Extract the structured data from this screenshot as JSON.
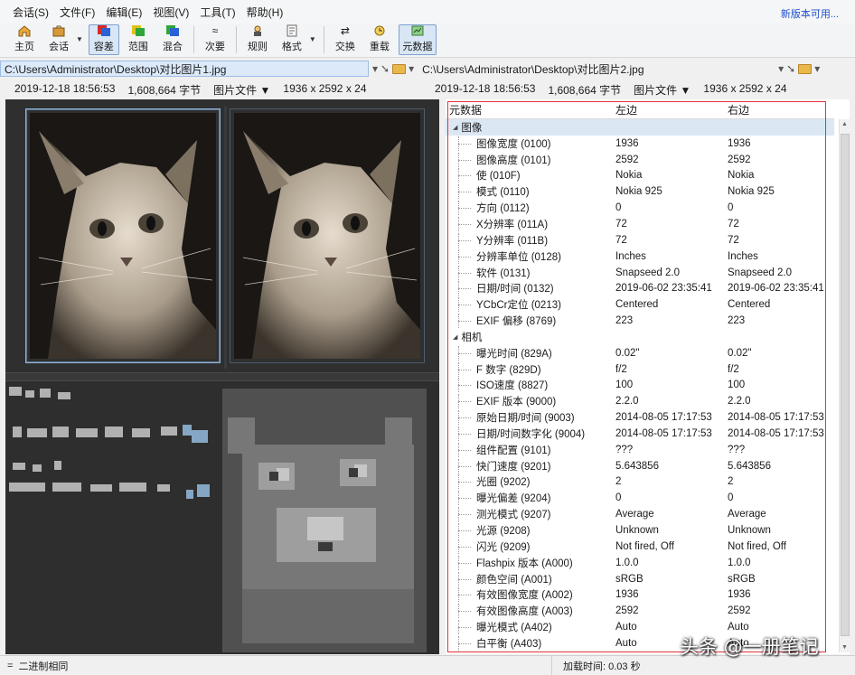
{
  "menu": {
    "items": [
      "会话(S)",
      "文件(F)",
      "编辑(E)",
      "视图(V)",
      "工具(T)",
      "帮助(H)"
    ],
    "update_link": "新版本可用..."
  },
  "toolbar": {
    "home": "主页",
    "session": "会话",
    "diff": "容差",
    "range": "范围",
    "mix": "混合",
    "minor": "次要",
    "rules": "规则",
    "format": "格式",
    "swap": "交换",
    "reload": "重载",
    "metadata": "元数据"
  },
  "paths": {
    "left": "C:\\Users\\Administrator\\Desktop\\对比图片1.jpg",
    "right": "C:\\Users\\Administrator\\Desktop\\对比图片2.jpg"
  },
  "file_info": {
    "left": {
      "date": "2019-12-18 18:56:53",
      "size": "1,608,664 字节",
      "type": "图片文件",
      "dims": "1936 x 2592 x 24"
    },
    "right": {
      "date": "2019-12-18 18:56:53",
      "size": "1,608,664 字节",
      "type": "图片文件",
      "dims": "1936 x 2592 x 24"
    }
  },
  "meta_table": {
    "headers": [
      "元数据",
      "左边",
      "右边"
    ],
    "groups": [
      {
        "name": "图像",
        "rows": [
          [
            "图像宽度 (0100)",
            "1936",
            "1936"
          ],
          [
            "图像高度 (0101)",
            "2592",
            "2592"
          ],
          [
            "使 (010F)",
            "Nokia",
            "Nokia"
          ],
          [
            "模式 (0110)",
            "Nokia 925",
            "Nokia 925"
          ],
          [
            "方向 (0112)",
            "0",
            "0"
          ],
          [
            "X分辨率 (011A)",
            "72",
            "72"
          ],
          [
            "Y分辨率 (011B)",
            "72",
            "72"
          ],
          [
            "分辨率单位 (0128)",
            "Inches",
            "Inches"
          ],
          [
            "软件 (0131)",
            "Snapseed 2.0",
            "Snapseed 2.0"
          ],
          [
            "日期/时间 (0132)",
            "2019-06-02 23:35:41",
            "2019-06-02 23:35:41"
          ],
          [
            "YCbCr定位 (0213)",
            "Centered",
            "Centered"
          ],
          [
            "EXIF 偏移 (8769)",
            "223",
            "223"
          ]
        ]
      },
      {
        "name": "相机",
        "rows": [
          [
            "曝光时间 (829A)",
            "0.02\"",
            "0.02\""
          ],
          [
            "F 数字 (829D)",
            "f/2",
            "f/2"
          ],
          [
            "ISO速度 (8827)",
            "100",
            "100"
          ],
          [
            "EXIF 版本 (9000)",
            "2.2.0",
            "2.2.0"
          ],
          [
            "原始日期/时间 (9003)",
            "2014-08-05 17:17:53",
            "2014-08-05 17:17:53"
          ],
          [
            "日期/时间数字化 (9004)",
            "2014-08-05 17:17:53",
            "2014-08-05 17:17:53"
          ],
          [
            "组件配置 (9101)",
            "???",
            "???"
          ],
          [
            "快门速度 (9201)",
            "5.643856",
            "5.643856"
          ],
          [
            "光圈 (9202)",
            "2",
            "2"
          ],
          [
            "曝光偏差 (9204)",
            "0",
            "0"
          ],
          [
            "测光模式 (9207)",
            "Average",
            "Average"
          ],
          [
            "光源 (9208)",
            "Unknown",
            "Unknown"
          ],
          [
            "闪光 (9209)",
            "Not fired, Off",
            "Not fired, Off"
          ],
          [
            "Flashpix 版本 (A000)",
            "1.0.0",
            "1.0.0"
          ],
          [
            "颜色空间 (A001)",
            "sRGB",
            "sRGB"
          ],
          [
            "有效图像宽度 (A002)",
            "1936",
            "1936"
          ],
          [
            "有效图像高度 (A003)",
            "2592",
            "2592"
          ],
          [
            "曝光模式 (A402)",
            "Auto",
            "Auto"
          ],
          [
            "白平衡 (A403)",
            "Auto",
            "Auto"
          ]
        ]
      }
    ]
  },
  "status": {
    "left": "二进制相同",
    "right": "加载时间: 0.03 秒"
  },
  "watermark": "头条 @一册笔记",
  "icons": {
    "home": "home-icon",
    "session": "briefcase-icon",
    "diff": "diff-icon",
    "range": "range-icon",
    "mix": "mix-icon",
    "minor": "approx-icon",
    "rules": "rules-icon",
    "format": "format-icon",
    "swap": "swap-icon",
    "reload": "reload-icon",
    "metadata": "metadata-icon"
  },
  "colors": {
    "accent": "#1e4fd0",
    "selection": "#e2333b",
    "path_bg": "#dbe9f9"
  }
}
